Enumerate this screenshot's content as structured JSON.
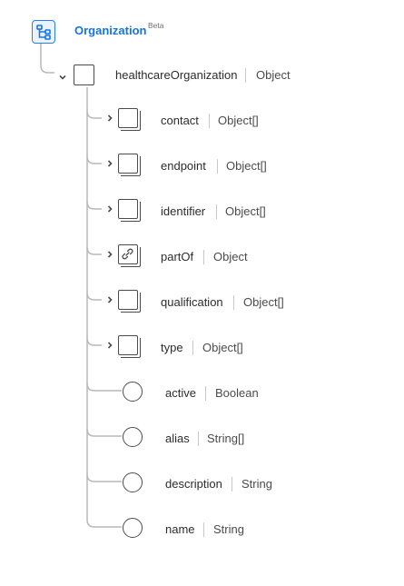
{
  "schema": {
    "title": "Organization",
    "badge": "Beta",
    "icon": "schema-hierarchy-icon"
  },
  "root_field": {
    "name": "healthcareOrganization",
    "type": "Object",
    "icon": "object-box-icon"
  },
  "fields": [
    {
      "name": "contact",
      "type": "Object[]",
      "kind": "object-array"
    },
    {
      "name": "endpoint",
      "type": "Object[]",
      "kind": "object-array"
    },
    {
      "name": "identifier",
      "type": "Object[]",
      "kind": "object-array"
    },
    {
      "name": "partOf",
      "type": "Object",
      "kind": "reference"
    },
    {
      "name": "qualification",
      "type": "Object[]",
      "kind": "object-array"
    },
    {
      "name": "type",
      "type": "Object[]",
      "kind": "object-array"
    },
    {
      "name": "active",
      "type": "Boolean",
      "kind": "primitive"
    },
    {
      "name": "alias",
      "type": "String[]",
      "kind": "primitive"
    },
    {
      "name": "description",
      "type": "String",
      "kind": "primitive"
    },
    {
      "name": "name",
      "type": "String",
      "kind": "primitive"
    }
  ],
  "colors": {
    "accent": "#1473e6",
    "line": "#b5b5b5",
    "icon_stroke": "#4b4b4b"
  }
}
